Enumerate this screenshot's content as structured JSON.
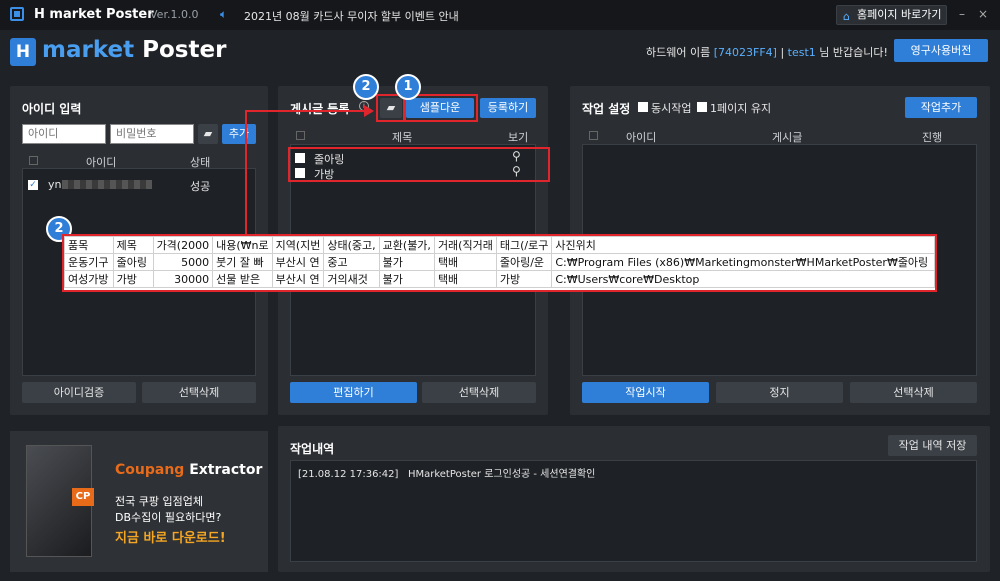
{
  "titlebar": {
    "app_title": "H market Poster",
    "version": "Ver.1.0.0",
    "notice": "2021년 08월 카드사 무이자 할부 이벤트 안내",
    "homepage_label": "홈페이지 바로가기",
    "minimize": "–",
    "close": "×"
  },
  "logo": {
    "h": "H",
    "market": "market",
    "poster": "Poster"
  },
  "header": {
    "hw_prefix": "하드웨어 이름",
    "hw_id": "[74023FF4]",
    "sep": "|",
    "user": "test1",
    "greeting": "님 반갑습니다!",
    "permanent_button": "영구사용버전"
  },
  "id_panel": {
    "title": "아이디 입력",
    "id_placeholder": "아이디",
    "pw_placeholder": "비밀번호",
    "add_button": "추가",
    "columns": [
      "아이디",
      "상태"
    ],
    "rows": [
      {
        "id": "yn",
        "status": "성공"
      }
    ],
    "verify_button": "아이디검증",
    "delete_button": "선택삭제"
  },
  "post_panel": {
    "title": "게시글 등록",
    "sample_button": "샘플다운",
    "register_button": "등록하기",
    "columns": [
      "제목",
      "보기"
    ],
    "rows": [
      {
        "title": "줄아링"
      },
      {
        "title": "가방"
      }
    ],
    "edit_button": "편집하기",
    "delete_button": "선택삭제"
  },
  "work_panel": {
    "title": "작업 설정",
    "simultaneous": "동시작업",
    "keep_page": "1페이지 유지",
    "add_button": "작업추가",
    "columns": [
      "아이디",
      "게시글",
      "진행"
    ],
    "start_button": "작업시작",
    "stop_button": "정지",
    "delete_button": "선택삭제"
  },
  "log_panel": {
    "title": "작업내역",
    "save_button": "작업 내역 저장",
    "entries": [
      "[21.08.12 17:36:42]   HMarketPoster 로그인성공 - 세션연결확인"
    ]
  },
  "ad": {
    "brand_a": "Coupang",
    "brand_b": " Extractor",
    "cp": "CP",
    "line1": "전국 쿠팡 입점업체",
    "line2": "DB수집이 필요하다면?",
    "line3": "지금 바로 다운로드!"
  },
  "markers": {
    "one": "1",
    "two": "2"
  },
  "sheet": {
    "rows": [
      [
        "품목",
        "제목",
        "가격(2000",
        "내용(₩n로",
        "지역(지번",
        "상태(중고,",
        "교환(불가,",
        "거래(직거래",
        "태그(/로구",
        "사진위치"
      ],
      [
        "운동기구",
        "줄아링",
        "5000",
        "붓기 잘 빠",
        "부산시 연",
        "중고",
        "불가",
        "택배",
        "줄아링/운",
        "C:₩Program Files (x86)₩Marketingmonster₩HMarketPoster₩줄아링"
      ],
      [
        "여성가방",
        "가방",
        "30000",
        "선물 받은",
        "부산시 연",
        "거의새것",
        "불가",
        "택배",
        "가방",
        "C:₩Users₩core₩Desktop"
      ]
    ]
  }
}
